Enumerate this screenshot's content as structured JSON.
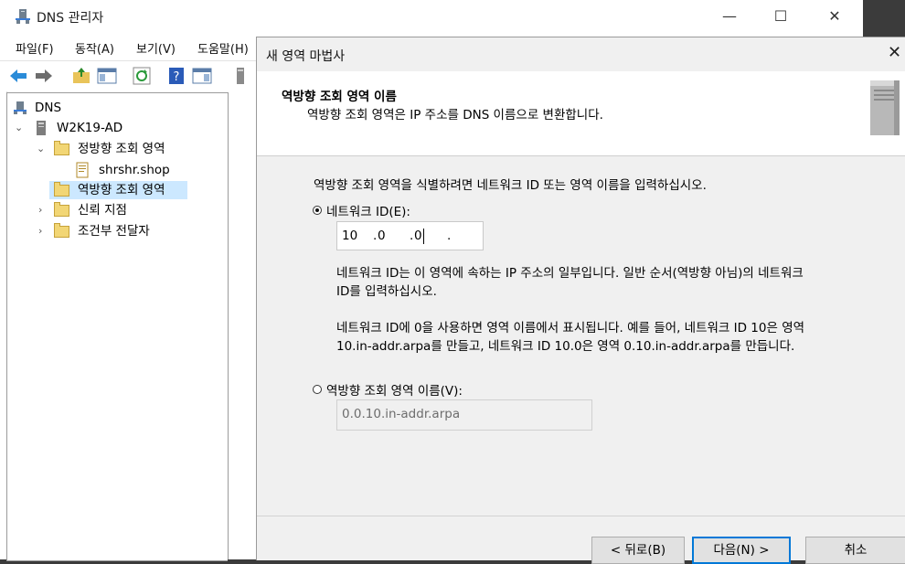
{
  "window": {
    "title": "DNS 관리자",
    "minimize_icon": "minimize-icon",
    "maximize_icon": "maximize-icon",
    "close_icon": "close-icon"
  },
  "menu": [
    "파일(F)",
    "동작(A)",
    "보기(V)",
    "도움말(H)"
  ],
  "toolbar": [
    "back-arrow-icon",
    "forward-arrow-icon",
    "up-folder-icon",
    "show-hide-tree-icon",
    "refresh-icon",
    "help-icon",
    "properties-icon",
    "server-icon"
  ],
  "tree": {
    "root": "DNS",
    "server": "W2K19-AD",
    "forward_zones": "정방향 조회 영역",
    "zone_item": "shrshr.shop",
    "reverse_zones": "역방향 조회 영역",
    "trust_points": "신뢰 지점",
    "conditional_forwarders": "조건부 전달자"
  },
  "wizard": {
    "title": "새 영역 마법사",
    "header_title": "역방향 조회 영역 이름",
    "header_subtitle": "역방향 조회 영역은 IP 주소를 DNS 이름으로 변환합니다.",
    "instruction": "역방향 조회 영역을 식별하려면 네트워크 ID 또는 영역 이름을 입력하십시오.",
    "network_id_label": "네트워크 ID(E):",
    "network_id_octets": [
      "10",
      "0",
      "0",
      ""
    ],
    "desc1_line1": "네트워크 ID는 이 영역에 속하는 IP 주소의 일부입니다. 일반 순서(역방향 아님)의 네트워크",
    "desc1_line2": "ID를 입력하십시오.",
    "desc2_line1": "네트워크 ID에 0을 사용하면 영역 이름에서 표시됩니다. 예를 들어, 네트워크 ID 10은 영역",
    "desc2_line2": "10.in-addr.arpa를 만들고, 네트워크 ID 10.0은 영역 0.10.in-addr.arpa를 만듭니다.",
    "zone_name_label": "역방향 조회 영역 이름(V):",
    "zone_name_value": "0.0.10.in-addr.arpa",
    "selected_option": "network_id",
    "back_button": "< 뒤로(B)",
    "next_button": "다음(N) >",
    "cancel_button": "취소"
  }
}
